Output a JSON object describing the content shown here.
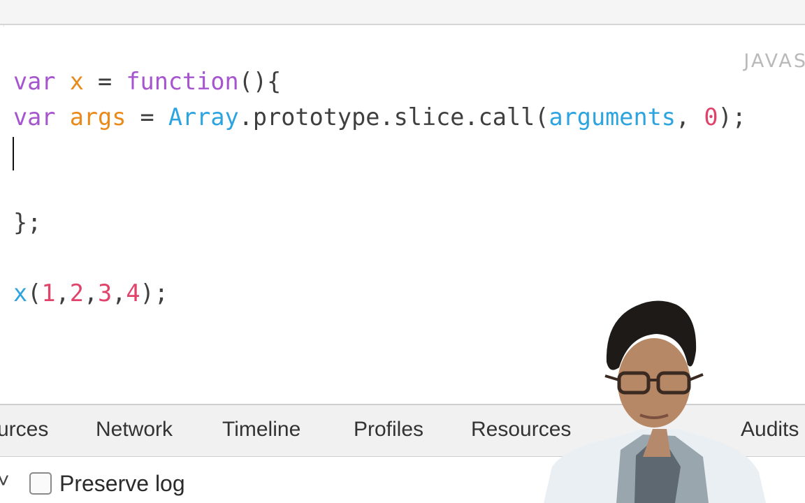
{
  "editor": {
    "language_label": "JAVAS",
    "lines": [
      [
        {
          "t": "var",
          "c": "kw"
        },
        {
          "t": " ",
          "c": "plain"
        },
        {
          "t": "x",
          "c": "var"
        },
        {
          "t": " = ",
          "c": "plain"
        },
        {
          "t": "function",
          "c": "kw"
        },
        {
          "t": "(){",
          "c": "plain"
        }
      ],
      [
        {
          "t": "var",
          "c": "kw"
        },
        {
          "t": " ",
          "c": "plain"
        },
        {
          "t": "args",
          "c": "var"
        },
        {
          "t": " = ",
          "c": "plain"
        },
        {
          "t": "Array",
          "c": "fn"
        },
        {
          "t": ".prototype.slice.call(",
          "c": "plain"
        },
        {
          "t": "arguments",
          "c": "fn"
        },
        {
          "t": ", ",
          "c": "plain"
        },
        {
          "t": "0",
          "c": "num"
        },
        {
          "t": ");",
          "c": "plain"
        }
      ],
      [],
      [],
      [
        {
          "t": "};",
          "c": "plain"
        }
      ],
      [],
      [
        {
          "t": "x",
          "c": "fn"
        },
        {
          "t": "(",
          "c": "plain"
        },
        {
          "t": "1",
          "c": "num"
        },
        {
          "t": ",",
          "c": "plain"
        },
        {
          "t": "2",
          "c": "num"
        },
        {
          "t": ",",
          "c": "plain"
        },
        {
          "t": "3",
          "c": "num"
        },
        {
          "t": ",",
          "c": "plain"
        },
        {
          "t": "4",
          "c": "num"
        },
        {
          "t": ");",
          "c": "plain"
        }
      ]
    ]
  },
  "devtools": {
    "tabs": [
      {
        "label": "urces"
      },
      {
        "label": "Network"
      },
      {
        "label": "Timeline"
      },
      {
        "label": "Profiles"
      },
      {
        "label": "Resources"
      },
      {
        "label": "Audits"
      }
    ],
    "console": {
      "filter_glyph": "˅",
      "preserve_log_label": "Preserve log",
      "preserve_log_checked": false
    }
  },
  "colors": {
    "keyword": "#a655cf",
    "variable": "#ea8a1b",
    "function": "#2da4df",
    "number": "#e0426a"
  }
}
